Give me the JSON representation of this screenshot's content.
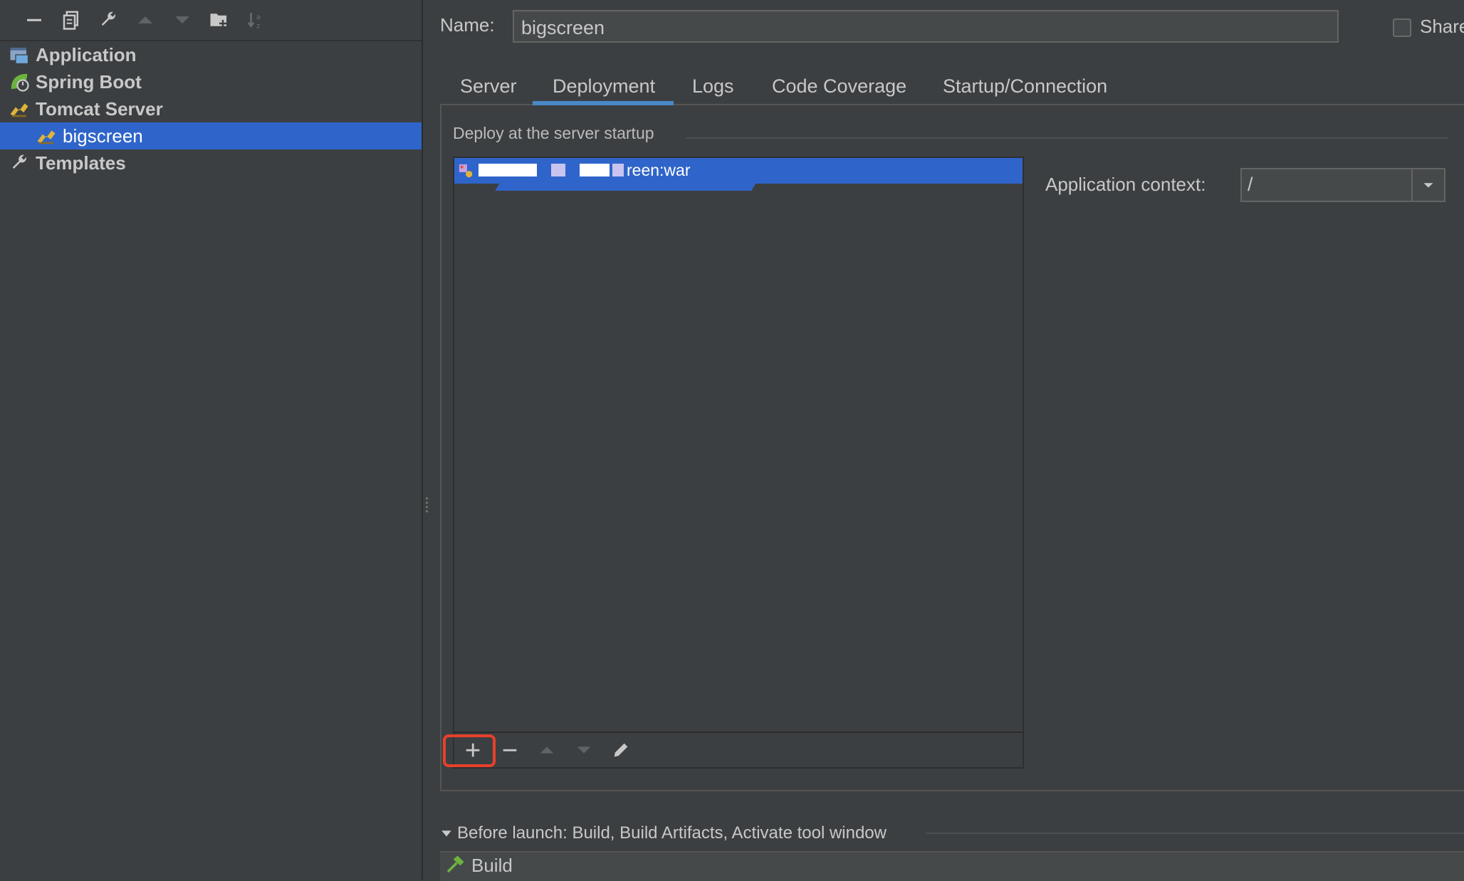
{
  "toolbar": {
    "icons": [
      "minus-icon",
      "copy-icon",
      "wrench-icon",
      "move-up-icon",
      "move-down-icon",
      "new-folder-icon",
      "sort-icon"
    ]
  },
  "tree": {
    "items": [
      {
        "label": "Application",
        "icon": "application-icon"
      },
      {
        "label": "Spring Boot",
        "icon": "spring-boot-icon"
      },
      {
        "label": "Tomcat Server",
        "icon": "tomcat-icon"
      },
      {
        "label": "bigscreen",
        "icon": "tomcat-icon",
        "selected": true
      },
      {
        "label": "Templates",
        "icon": "wrench-icon"
      }
    ]
  },
  "form": {
    "name_label": "Name:",
    "name_value": "bigscreen",
    "share_label": "Share",
    "share_checked": false
  },
  "tabs": [
    "Server",
    "Deployment",
    "Logs",
    "Code Coverage",
    "Startup/Connection"
  ],
  "active_tab": "Deployment",
  "deployment": {
    "section_title": "Deploy at the server startup",
    "artifacts": [
      {
        "label": "reen:war",
        "selected": true
      }
    ],
    "context_label": "Application context:",
    "context_value": "/"
  },
  "before_launch": {
    "label": "Before launch: Build, Build Artifacts, Activate tool window",
    "tasks": [
      {
        "label": "Build",
        "icon": "hammer-icon"
      }
    ]
  },
  "colors": {
    "background": "#3c3f41",
    "selection": "#2f65ca",
    "tab_underline": "#4a88c7",
    "highlight_box": "#e8402a"
  }
}
